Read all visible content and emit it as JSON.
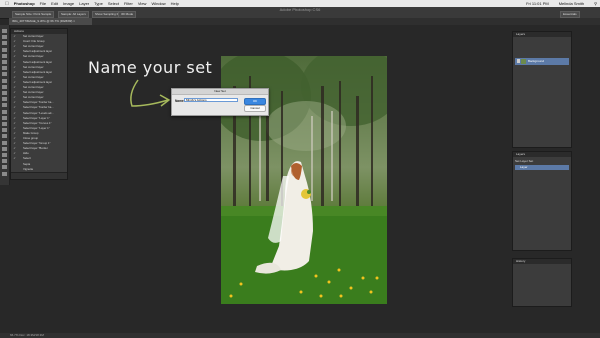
{
  "menubar": {
    "apple": "",
    "items": [
      "Photoshop",
      "File",
      "Edit",
      "Image",
      "Layer",
      "Type",
      "Select",
      "Filter",
      "View",
      "Window",
      "Help"
    ],
    "clock": "Fri 11:01 PM",
    "user": "Melinda Smith"
  },
  "window_title": "Adobe Photoshop CS6",
  "options": [
    "Sample Size: Point Sample",
    "Sample: All Layers",
    "Show Sampling Ring",
    "3D Mode",
    "Essentials"
  ],
  "doc_tab": "IMG_4077IMAGE_9.JPG @ 66.7% (RGB/8#) ×",
  "actions_panel": {
    "title": "Actions",
    "rows": [
      {
        "label": "Set current layer",
        "checked": true
      },
      {
        "label": "Invert: File Group",
        "checked": true
      },
      {
        "label": "Set current layer",
        "checked": true
      },
      {
        "label": "Select adjustment layer",
        "checked": true
      },
      {
        "label": "Set current layer",
        "checked": true
      },
      {
        "label": "Select adjustment layer",
        "checked": true
      },
      {
        "label": "Set current layer",
        "checked": true
      },
      {
        "label": "Select adjustment layer",
        "checked": true
      },
      {
        "label": "Set current layer",
        "checked": true
      },
      {
        "label": "Select adjustment layer",
        "checked": true
      },
      {
        "label": "Set current layer",
        "checked": true
      },
      {
        "label": "Set current layer",
        "checked": true
      },
      {
        "label": "Set current layer",
        "checked": true
      },
      {
        "label": "Select layer \"border ba...",
        "checked": true
      },
      {
        "label": "Select layer \"border ba...",
        "checked": true
      },
      {
        "label": "Select layer \"Levels ad...",
        "checked": true
      },
      {
        "label": "Select layer \"Layer 1\"",
        "checked": true
      },
      {
        "label": "Select layer \"Curves 1\"",
        "checked": true
      },
      {
        "label": "Select layer \"Layer 1\"",
        "checked": true
      },
      {
        "label": "Make Group",
        "checked": true
      },
      {
        "label": "Close group",
        "checked": true
      },
      {
        "label": "Select layer \"Group 1\"",
        "checked": true
      },
      {
        "label": "Select layer \"Border",
        "checked": true
      },
      {
        "label": "Hide",
        "checked": true
      },
      {
        "label": "Select",
        "checked": true
      },
      {
        "label": "Sepia",
        "checked": false
      },
      {
        "label": "Vignette",
        "checked": false
      }
    ]
  },
  "annotation": "Name your set",
  "dialog": {
    "title": "New Set",
    "name_label": "Name:",
    "name_value": "Mindy's Actions",
    "ok": "OK",
    "cancel": "Cancel"
  },
  "right_panels": {
    "top_title": "Layers",
    "layer_name": "Background",
    "mid_title": "Layers",
    "mid_items": [
      "Set Layer Set",
      "Layer"
    ],
    "bottom_title": "History"
  },
  "status": "66.7%    Doc: 18.3M/18.3M"
}
